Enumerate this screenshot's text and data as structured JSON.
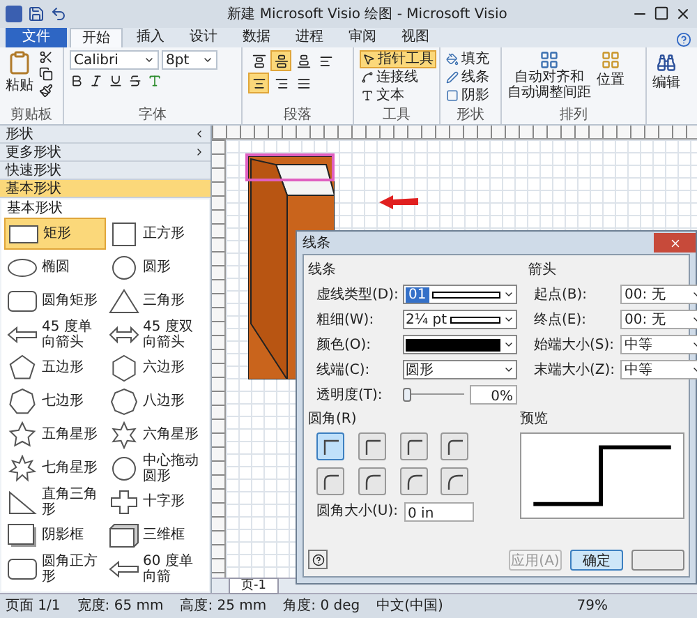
{
  "window": {
    "title": "新建 Microsoft Visio 绘图 - Microsoft Visio"
  },
  "tabs": [
    {
      "label": "文件",
      "kind": "file",
      "selected": false
    },
    {
      "label": "开始",
      "kind": "tab",
      "selected": true
    },
    {
      "label": "插入",
      "kind": "tab",
      "selected": false
    },
    {
      "label": "设计",
      "kind": "tab",
      "selected": false
    },
    {
      "label": "数据",
      "kind": "tab",
      "selected": false
    },
    {
      "label": "进程",
      "kind": "tab",
      "selected": false
    },
    {
      "label": "审阅",
      "kind": "tab",
      "selected": false
    },
    {
      "label": "视图",
      "kind": "tab",
      "selected": false
    }
  ],
  "ribbon": {
    "clipboard": {
      "paste": "粘贴",
      "label": "剪贴板"
    },
    "font": {
      "family": "Calibri",
      "size": "8pt",
      "label": "字体"
    },
    "paragraph": {
      "label": "段落",
      "buttons": [
        {
          "kind": "top",
          "selected": false
        },
        {
          "kind": "middle",
          "selected": true
        },
        {
          "kind": "bottom",
          "selected": false
        },
        {
          "kind": "left",
          "selected": false
        },
        {
          "kind": "center",
          "selected": true
        },
        {
          "kind": "right",
          "selected": false
        },
        {
          "kind": "justify",
          "selected": false
        }
      ]
    },
    "tools": {
      "label": "工具",
      "items": [
        {
          "label": "指针工具",
          "kind": "pointer",
          "selected": true
        },
        {
          "label": "连接线",
          "kind": "connector",
          "selected": false
        },
        {
          "label": "文本",
          "kind": "text",
          "selected": false
        }
      ]
    },
    "shape": {
      "label": "形状",
      "items": [
        {
          "label": "填充",
          "kind": "fill"
        },
        {
          "label": "线条",
          "kind": "line"
        },
        {
          "label": "阴影",
          "kind": "shadow"
        }
      ]
    },
    "arrange": {
      "label": "排列",
      "auto_align": [
        "自动对齐和",
        "自动调整间距"
      ],
      "position": "位置"
    },
    "edit": {
      "label": "编辑"
    }
  },
  "shapes_panel": {
    "headers": [
      {
        "label": "形状",
        "kind": "title",
        "selected": false
      },
      {
        "label": "更多形状",
        "kind": "menu",
        "selected": false
      },
      {
        "label": "快速形状",
        "kind": "stencil",
        "selected": false
      },
      {
        "label": "基本形状",
        "kind": "stencil",
        "selected": true
      }
    ],
    "stencil_title": "基本形状",
    "shapes": [
      {
        "label": "矩形",
        "kind": "rect",
        "selected": true
      },
      {
        "label": "正方形",
        "kind": "square",
        "selected": false
      },
      {
        "label": "椭圆",
        "kind": "ellipse",
        "selected": false
      },
      {
        "label": "圆形",
        "kind": "circle",
        "selected": false
      },
      {
        "label": "圆角矩形",
        "kind": "rounded",
        "selected": false
      },
      {
        "label": "三角形",
        "kind": "triangle",
        "selected": false
      },
      {
        "label": "45 度单向箭头",
        "kind": "arrow",
        "selected": false
      },
      {
        "label": "45 度双向箭头",
        "kind": "double-arrow",
        "selected": false
      },
      {
        "label": "五边形",
        "kind": "poly5",
        "selected": false
      },
      {
        "label": "六边形",
        "kind": "poly6",
        "selected": false
      },
      {
        "label": "七边形",
        "kind": "poly7",
        "selected": false
      },
      {
        "label": "八边形",
        "kind": "poly8",
        "selected": false
      },
      {
        "label": "五角星形",
        "kind": "star5",
        "selected": false
      },
      {
        "label": "六角星形",
        "kind": "star6",
        "selected": false
      },
      {
        "label": "七角星形",
        "kind": "star7",
        "selected": false
      },
      {
        "label": "中心拖动圆形",
        "kind": "circle",
        "selected": false
      },
      {
        "label": "直角三角形",
        "kind": "right-triangle",
        "selected": false
      },
      {
        "label": "十字形",
        "kind": "cross",
        "selected": false
      },
      {
        "label": "阴影框",
        "kind": "shadow-box",
        "selected": false
      },
      {
        "label": "三维框",
        "kind": "box3d",
        "selected": false
      },
      {
        "label": "圆角正方形",
        "kind": "rounded",
        "selected": false
      },
      {
        "label": "60 度单向箭",
        "kind": "arrow",
        "selected": false
      }
    ]
  },
  "page_tab": "页-1",
  "dialog": {
    "title": "线条",
    "line_section": "线条",
    "line_fields": [
      {
        "label": "虚线类型(D):",
        "kind": "dash",
        "value": "01"
      },
      {
        "label": "粗细(W):",
        "kind": "weight",
        "value": "2¼ pt"
      },
      {
        "label": "颜色(O):",
        "kind": "color"
      },
      {
        "label": "线端(C):",
        "kind": "select",
        "value": "圆形"
      },
      {
        "label": "透明度(T):",
        "kind": "slider",
        "level": 0,
        "reading": "0%"
      }
    ],
    "arrow_section": "箭头",
    "arrow_fields": [
      {
        "label": "起点(B):",
        "value": "00: 无"
      },
      {
        "label": "终点(E):",
        "value": "00: 无"
      },
      {
        "label": "始端大小(S):",
        "value": "中等"
      },
      {
        "label": "末端大小(Z):",
        "value": "中等"
      }
    ],
    "corner_section": "圆角(R)",
    "corners": [
      {
        "selected": true
      },
      {
        "selected": false
      },
      {
        "selected": false
      },
      {
        "selected": false
      },
      {
        "selected": false
      },
      {
        "selected": false
      },
      {
        "selected": false
      },
      {
        "selected": false
      }
    ],
    "corner_size": {
      "label": "圆角大小(U):",
      "value": "0 in"
    },
    "preview_section": "预览",
    "buttons": [
      {
        "label": "应用(A)",
        "kind": "apply",
        "disabled": true
      },
      {
        "label": "确定",
        "kind": "ok"
      },
      {
        "kind": "cancel"
      }
    ]
  },
  "status_bar": [
    {
      "label": "页面 1/1"
    },
    {
      "label": "宽度: 65 mm"
    },
    {
      "label": "高度: 25 mm"
    },
    {
      "label": "角度: 0 deg"
    },
    {
      "label": "中文(中国)"
    }
  ],
  "zoom": "79%"
}
